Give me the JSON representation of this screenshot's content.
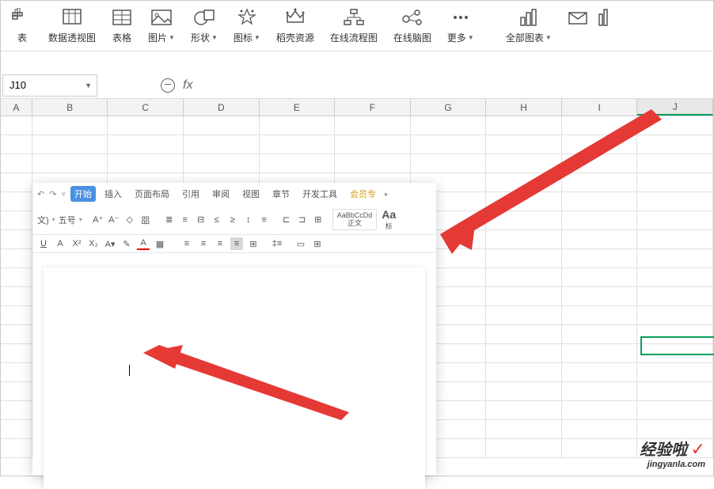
{
  "ribbon": {
    "items": [
      {
        "label": "表",
        "caret": false
      },
      {
        "label": "数据透视图",
        "caret": false
      },
      {
        "label": "表格",
        "caret": false
      },
      {
        "label": "图片",
        "caret": true
      },
      {
        "label": "形状",
        "caret": true
      },
      {
        "label": "图标",
        "caret": true
      },
      {
        "label": "稻壳资源",
        "caret": false
      },
      {
        "label": "在线流程图",
        "caret": false
      },
      {
        "label": "在线脑图",
        "caret": false
      },
      {
        "label": "更多",
        "caret": true
      },
      {
        "label": "全部图表",
        "caret": true
      }
    ]
  },
  "formula_bar": {
    "name_box": "J10",
    "fx": "fx"
  },
  "columns": [
    "A",
    "B",
    "C",
    "D",
    "E",
    "F",
    "G",
    "H",
    "I",
    "J"
  ],
  "selected_column": "J",
  "word_window": {
    "tabs": [
      "开始",
      "插入",
      "页面布局",
      "引用",
      "审阅",
      "视图",
      "章节",
      "开发工具",
      "会员专"
    ],
    "active_tab": "开始",
    "vip_tab": "会员专",
    "font_label": "文)",
    "font_size": "五号",
    "style_preview": "AaBbCcDd",
    "style_name": "正文",
    "style_aa": "Aa",
    "style_label": "标",
    "undo": "↶",
    "redo": "↷"
  },
  "watermark": {
    "main": "经验啦",
    "check": "✓",
    "sub": "jingyanla.com"
  }
}
